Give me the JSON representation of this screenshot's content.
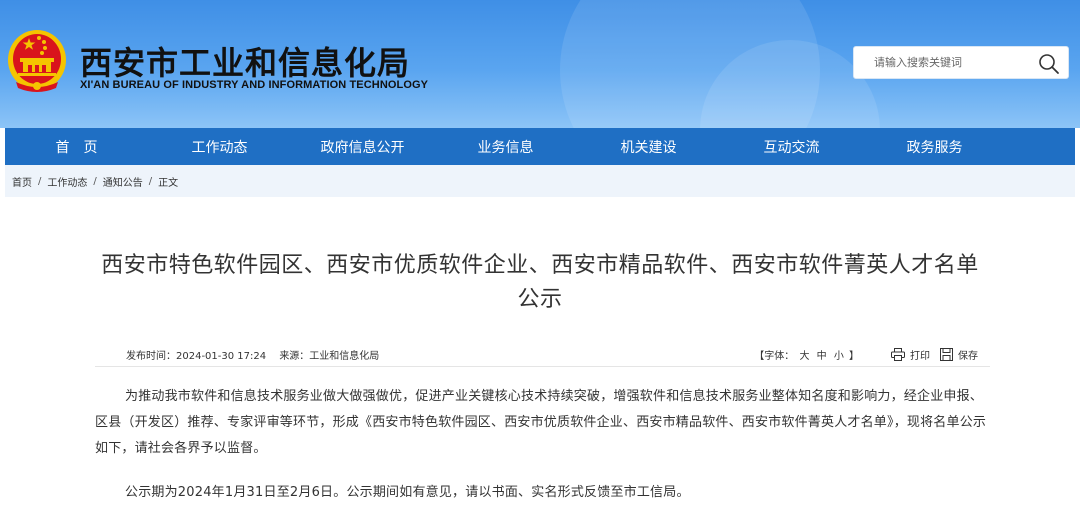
{
  "header": {
    "title": "西安市工业和信息化局",
    "subtitle": "XI'AN BUREAU OF INDUSTRY AND INFORMATION TECHNOLOGY",
    "emblem_icon": "national-emblem-icon"
  },
  "search": {
    "placeholder": "请输入搜索关键词",
    "icon": "search-icon"
  },
  "nav": {
    "items": [
      {
        "label": "首　页"
      },
      {
        "label": "工作动态"
      },
      {
        "label": "政府信息公开"
      },
      {
        "label": "业务信息"
      },
      {
        "label": "机关建设"
      },
      {
        "label": "互动交流"
      },
      {
        "label": "政务服务"
      }
    ]
  },
  "breadcrumb": {
    "items": [
      "首页",
      "工作动态",
      "通知公告",
      "正文"
    ],
    "separator": "/"
  },
  "article": {
    "title": "西安市特色软件园区、西安市优质软件企业、西安市精品软件、西安市软件菁英人才名单公示",
    "publish_time": "发布时间：2024-01-30 17:24",
    "source": "来源：工业和信息化局",
    "font_size_prefix": "【字体：",
    "font_size_large": "大",
    "font_size_medium": "中",
    "font_size_small": "小",
    "font_size_suffix": "】",
    "print_label": "打印",
    "save_label": "保存",
    "paragraphs": [
      "为推动我市软件和信息技术服务业做大做强做优，促进产业关键核心技术持续突破，增强软件和信息技术服务业整体知名度和影响力，经企业申报、区县（开发区）推荐、专家评审等环节，形成《西安市特色软件园区、西安市优质软件企业、西安市精品软件、西安市软件菁英人才名单》，现将名单公示如下，请社会各界予以监督。",
      "公示期为2024年1月31日至2月6日。公示期间如有意见，请以书面、实名形式反馈至市工信局。"
    ]
  },
  "colors": {
    "header_top": "#3f8fe6",
    "nav_bg": "#1f6fc4",
    "breadcrumb_bg": "#eef4fb",
    "emblem_red": "#d9141c",
    "emblem_gold": "#f5c400"
  }
}
